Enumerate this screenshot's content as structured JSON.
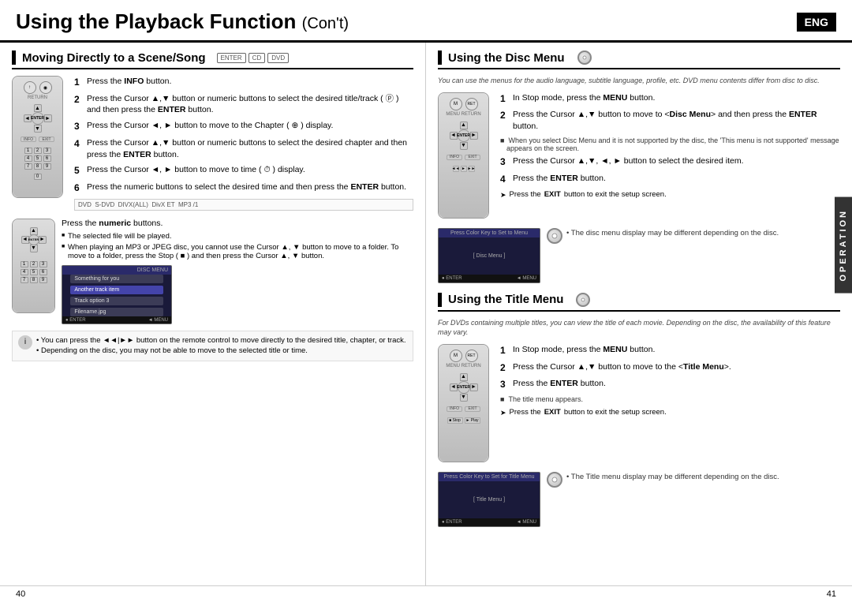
{
  "page": {
    "main_title": "Using the Playback Function",
    "title_suffix": "Con't",
    "eng_label": "ENG",
    "page_left": "40",
    "page_right": "41",
    "operation_label": "OPERATION"
  },
  "left_section": {
    "title": "Moving Directly to a Scene/Song",
    "icons": [
      "ENTER",
      "CD",
      "DVD"
    ],
    "sub_section1": {
      "steps": [
        {
          "num": "1",
          "text": "Press the ",
          "bold": "INFO",
          "after": " button."
        },
        {
          "num": "2",
          "text": "Press the Cursor ▲,▼ button or numeric buttons to select the desired title/track ( ) and then press the ",
          "bold": "ENTER",
          "after": " button."
        },
        {
          "num": "3",
          "text": "Press the Cursor ◄, ► button to move to the Chapter (  ) display."
        },
        {
          "num": "4",
          "text": "Press the Cursor ▲,▼ button or numeric buttons to select the desired chapter and then press the ",
          "bold": "ENTER",
          "after": " button."
        },
        {
          "num": "5",
          "text": "Press the Cursor ◄, ► button to move to time (  ) display."
        },
        {
          "num": "6",
          "text": "Press the numeric buttons to select the desired time and then press the ",
          "bold": "ENTER",
          "after": " button."
        }
      ],
      "bottom_note": "DVD  S-DVD  DIVX(ALL)  DivX ET  MP3 /1"
    },
    "sub_section2": {
      "press_text": "Press the ",
      "press_bold": "numeric",
      "press_after": " buttons.",
      "bullets": [
        "The selected file will be played.",
        "When playing an MP3 or JPEG disc, you cannot use the Cursor ▲, ▼ button to move to a folder. To move to a folder, press the Stop (  ) button and then press the Cursor ▲, ▼ button."
      ]
    },
    "info_note": {
      "bullets": [
        "You can press the ◄◄|►► button on the remote control to move directly to the desired title, chapter, or track.",
        "Depending on the disc, you may not be able to move to the selected title or time."
      ]
    }
  },
  "right_section": {
    "disc_menu": {
      "title": "Using the Disc Menu",
      "subtitle": "You can use the menus for the audio language, subtitle language, profile, etc. DVD menu contents differ from disc to disc.",
      "steps": [
        {
          "num": "1",
          "text": "In Stop mode, press the ",
          "bold": "MENU",
          "after": " button."
        },
        {
          "num": "2",
          "text": "Press the Cursor ▲,▼ button to move to <",
          "bold": "Disc Menu",
          "after": "> and then press the ",
          "bold2": "ENTER",
          "after2": " button."
        },
        {
          "num": "3",
          "text": "Press the Cursor ▲,▼, ◄, ► button to select the desired item."
        },
        {
          "num": "4",
          "text": "Press the ",
          "bold": "ENTER",
          "after": " button."
        }
      ],
      "bullet": "When you select Disc Menu and it is not supported by the disc, the 'This menu is not supported' message appears on the screen.",
      "exit_note": "Press the EXIT button to exit the setup screen.",
      "disc_note": "• The disc menu display may be different depending on the disc."
    },
    "title_menu": {
      "title": "Using the Title Menu",
      "subtitle": "For DVDs containing multiple titles, you can view the title of each movie. Depending on the disc, the availability of this feature may vary.",
      "steps": [
        {
          "num": "1",
          "text": "In Stop mode, press the ",
          "bold": "MENU",
          "after": " button."
        },
        {
          "num": "2",
          "text": "Press the Cursor ▲,▼ button to move to the <",
          "bold": "Title Menu",
          "after": ">."
        },
        {
          "num": "3",
          "text": "Press the ",
          "bold": "ENTER",
          "after": " button."
        }
      ],
      "bullet": "The title menu appears.",
      "exit_note": "Press the EXIT button to exit the setup screen.",
      "disc_note": "• The Title menu display may be different depending on the disc."
    }
  }
}
